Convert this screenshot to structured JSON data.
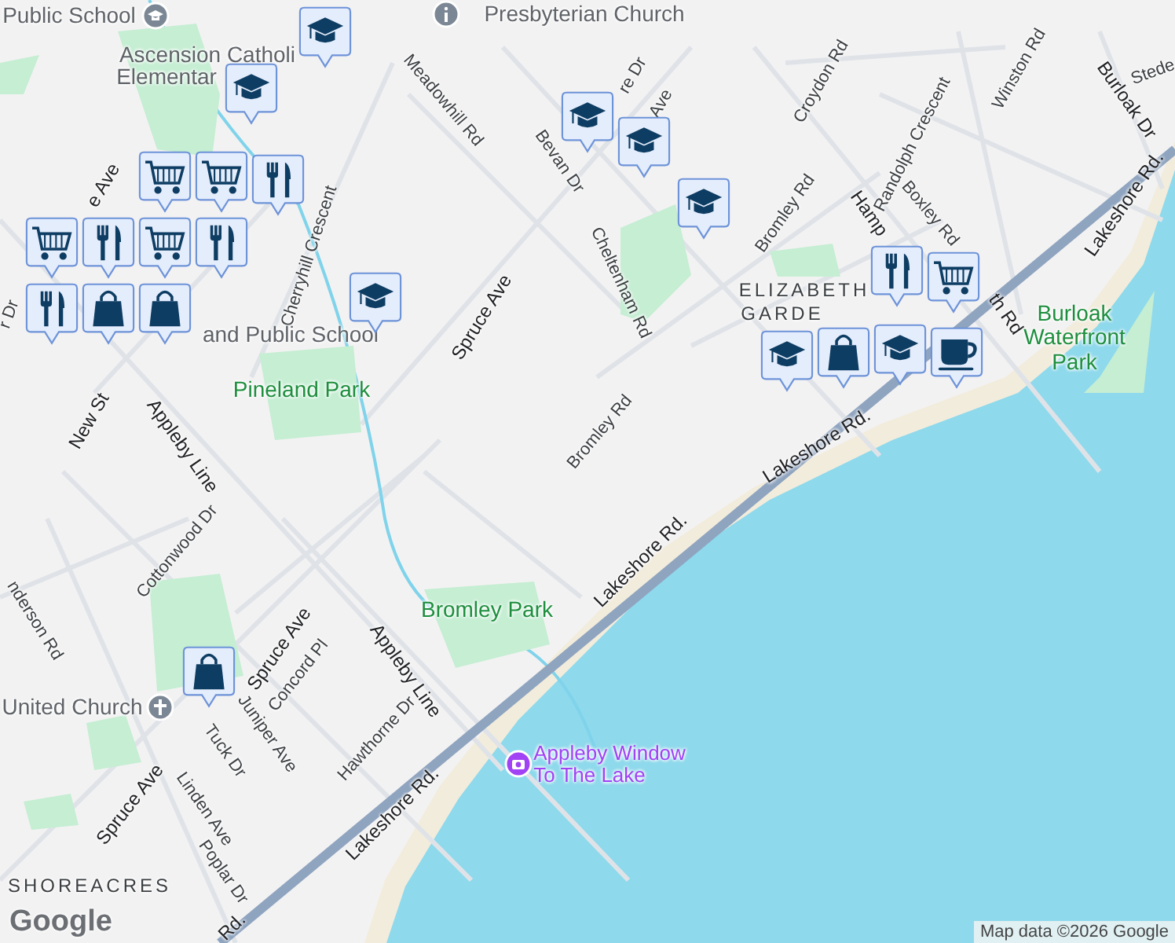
{
  "map": {
    "labels": [
      {
        "text": "Public School",
        "kind": "poi"
      },
      {
        "text": "Presbyterian Church",
        "kind": "poi"
      },
      {
        "text": "Ascension Catholi",
        "kind": "poi"
      },
      {
        "text": "Elementar",
        "kind": "poi"
      },
      {
        "text": "re Dr",
        "kind": "road"
      },
      {
        "text": "Croydon Rd",
        "kind": "road"
      },
      {
        "text": "Winston Rd",
        "kind": "road"
      },
      {
        "text": "Stede",
        "kind": "road"
      },
      {
        "text": "Meadowhill Rd",
        "kind": "road"
      },
      {
        "text": "Ave",
        "kind": "road"
      },
      {
        "text": "Burloak Dr",
        "kind": "major"
      },
      {
        "text": "Randolph Crescent",
        "kind": "road"
      },
      {
        "text": "Bevan Dr",
        "kind": "road"
      },
      {
        "text": "e Ave",
        "kind": "major"
      },
      {
        "text": "Lakeshore Rd.",
        "kind": "major"
      },
      {
        "text": "Bromley Rd",
        "kind": "road"
      },
      {
        "text": "Hamp",
        "kind": "major"
      },
      {
        "text": "Boxley Rd",
        "kind": "road"
      },
      {
        "text": "Cherryhill Crescent",
        "kind": "road"
      },
      {
        "text": "Cheltenham Rd",
        "kind": "road"
      },
      {
        "text": "ELIZABETH",
        "kind": "area"
      },
      {
        "text": "r Dr",
        "kind": "road"
      },
      {
        "text": "Spruce Ave",
        "kind": "major"
      },
      {
        "text": "GARDE",
        "kind": "area"
      },
      {
        "text": "th Rd",
        "kind": "major"
      },
      {
        "text": "and Public School",
        "kind": "poi"
      },
      {
        "text": "Burloak\nWaterfront\nPark",
        "kind": "park"
      },
      {
        "text": "Pineland Park",
        "kind": "park"
      },
      {
        "text": "New St",
        "kind": "major"
      },
      {
        "text": "Bromley Rd",
        "kind": "road"
      },
      {
        "text": "Appleby Line",
        "kind": "major"
      },
      {
        "text": "Lakeshore Rd.",
        "kind": "major"
      },
      {
        "text": "Cottonwood Dr",
        "kind": "road"
      },
      {
        "text": "Lakeshore Rd.",
        "kind": "major"
      },
      {
        "text": "nderson Rd",
        "kind": "road"
      },
      {
        "text": "Bromley Park",
        "kind": "park"
      },
      {
        "text": "Spruce Ave",
        "kind": "major"
      },
      {
        "text": "Concord Pl",
        "kind": "road"
      },
      {
        "text": "Appleby Line",
        "kind": "major"
      },
      {
        "text": "United Church",
        "kind": "poi"
      },
      {
        "text": "Tuck Dr",
        "kind": "road"
      },
      {
        "text": "Juniper Ave",
        "kind": "road"
      },
      {
        "text": "Hawthorne Dr",
        "kind": "road"
      },
      {
        "text": "Appleby Window\nTo The Lake",
        "kind": "attraction"
      },
      {
        "text": "Spruce Ave",
        "kind": "major"
      },
      {
        "text": "Linden Ave",
        "kind": "road"
      },
      {
        "text": "Lakeshore Rd.",
        "kind": "major"
      },
      {
        "text": "Poplar Dr",
        "kind": "road"
      },
      {
        "text": "SHOREACRES",
        "kind": "area"
      },
      {
        "text": "Rd.",
        "kind": "major"
      }
    ],
    "markers": [
      {
        "kind": "school"
      },
      {
        "kind": "school"
      },
      {
        "kind": "school"
      },
      {
        "kind": "school"
      },
      {
        "kind": "school"
      },
      {
        "kind": "school"
      },
      {
        "kind": "cart"
      },
      {
        "kind": "cart"
      },
      {
        "kind": "food"
      },
      {
        "kind": "cart"
      },
      {
        "kind": "food"
      },
      {
        "kind": "cart"
      },
      {
        "kind": "food"
      },
      {
        "kind": "food"
      },
      {
        "kind": "bag"
      },
      {
        "kind": "bag"
      },
      {
        "kind": "food"
      },
      {
        "kind": "cart"
      },
      {
        "kind": "school"
      },
      {
        "kind": "bag"
      },
      {
        "kind": "school"
      },
      {
        "kind": "cup"
      },
      {
        "kind": "bag"
      }
    ],
    "logo": "Google",
    "attribution": "Map data ©2026 Google"
  }
}
